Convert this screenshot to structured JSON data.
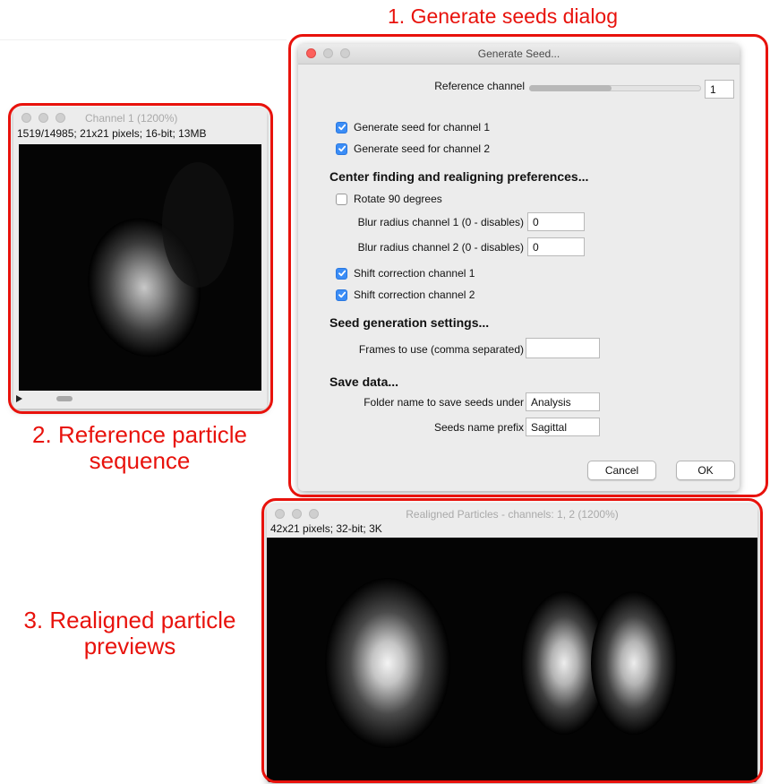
{
  "annotations": {
    "generate_dialog": "1. Generate seeds dialog",
    "reference_line1": "2. Reference particle",
    "reference_line2": "sequence",
    "realigned_line1": "3. Realigned particle",
    "realigned_line2": "previews"
  },
  "colors": {
    "annotation": "#e8120c",
    "checkbox_checked": "#3b8df6",
    "close_button": "#fc605c"
  },
  "dialog": {
    "title": "Generate Seed...",
    "reference_channel_label": "Reference channel",
    "reference_channel_value": "1",
    "reference_channel_slider_level": 0.48,
    "gen_seed_ch1": {
      "label": "Generate seed for channel 1",
      "checked": true
    },
    "gen_seed_ch2": {
      "label": "Generate seed for channel 2",
      "checked": true
    },
    "center_heading": "Center finding and realigning preferences...",
    "rotate": {
      "label": "Rotate 90 degrees",
      "checked": false
    },
    "blur1_label": "Blur radius channel 1 (0 - disables)",
    "blur1_value": "0",
    "blur2_label": "Blur radius channel 2 (0 - disables)",
    "blur2_value": "0",
    "shift_ch1": {
      "label": "Shift correction channel 1",
      "checked": true
    },
    "shift_ch2": {
      "label": "Shift correction channel 2",
      "checked": true
    },
    "seed_heading": "Seed generation settings...",
    "frames_label": "Frames to use (comma separated)",
    "frames_value": "",
    "save_heading": "Save data...",
    "folder_label": "Folder name to save seeds under",
    "folder_value": "Analysis",
    "prefix_label": "Seeds name prefix",
    "prefix_value": "Sagittal",
    "cancel_label": "Cancel",
    "ok_label": "OK"
  },
  "channel_window": {
    "title": "Channel 1 (1200%)",
    "info": "1519/14985; 21x21 pixels; 16-bit; 13MB"
  },
  "realigned_window": {
    "title": "Realigned Particles - channels: 1, 2 (1200%)",
    "info": "42x21 pixels; 32-bit; 3K"
  }
}
